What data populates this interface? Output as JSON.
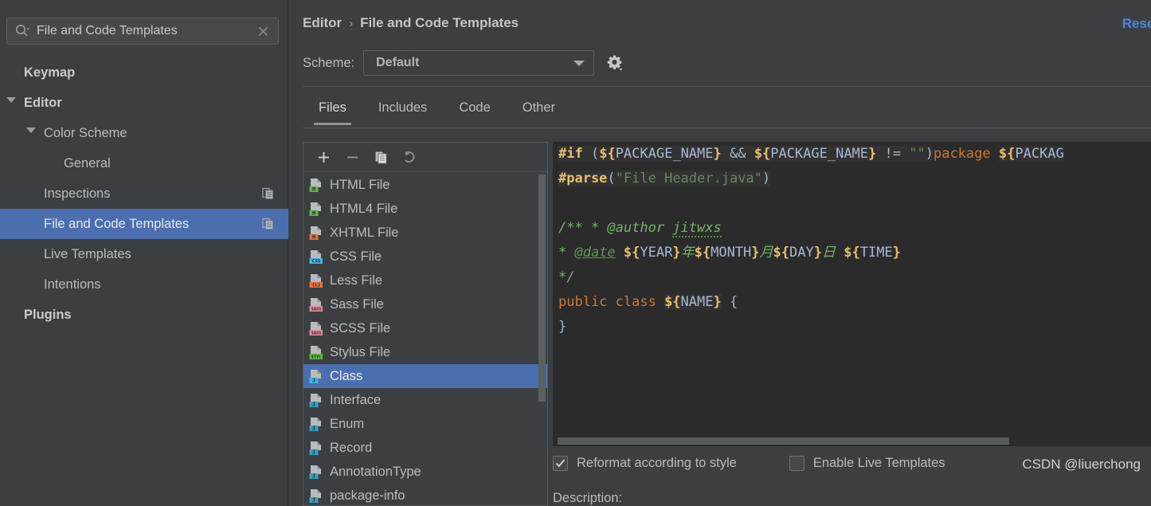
{
  "search": {
    "value": "File and Code Templates",
    "placeholder": "",
    "icon": "search-icon",
    "clear_icon": "close-icon"
  },
  "sidebar": {
    "items": [
      {
        "label": "Keymap",
        "indent": 30,
        "bold": true,
        "twisty": null,
        "selected": false,
        "copy_badge": false
      },
      {
        "label": "Editor",
        "indent": 30,
        "bold": true,
        "twisty": "down",
        "selected": false,
        "copy_badge": false
      },
      {
        "label": "Color Scheme",
        "indent": 55,
        "bold": false,
        "twisty": "down",
        "selected": false,
        "copy_badge": false
      },
      {
        "label": "General",
        "indent": 80,
        "bold": false,
        "twisty": null,
        "selected": false,
        "copy_badge": false
      },
      {
        "label": "Inspections",
        "indent": 55,
        "bold": false,
        "twisty": null,
        "selected": false,
        "copy_badge": true
      },
      {
        "label": "File and Code Templates",
        "indent": 55,
        "bold": false,
        "twisty": null,
        "selected": true,
        "copy_badge": true
      },
      {
        "label": "Live Templates",
        "indent": 55,
        "bold": false,
        "twisty": null,
        "selected": false,
        "copy_badge": false
      },
      {
        "label": "Intentions",
        "indent": 55,
        "bold": false,
        "twisty": null,
        "selected": false,
        "copy_badge": false
      },
      {
        "label": "Plugins",
        "indent": 30,
        "bold": true,
        "twisty": null,
        "selected": false,
        "copy_badge": false
      }
    ]
  },
  "header": {
    "breadcrumb_parent": "Editor",
    "breadcrumb_sep": "›",
    "breadcrumb_current": "File and Code Templates",
    "reset_label": "Reset",
    "scheme_label": "Scheme:",
    "scheme_value": "Default",
    "gear_icon": "gear-icon"
  },
  "tabs": [
    {
      "label": "Files",
      "active": true
    },
    {
      "label": "Includes",
      "active": false
    },
    {
      "label": "Code",
      "active": false
    },
    {
      "label": "Other",
      "active": false
    }
  ],
  "list_toolbar": [
    {
      "name": "add-template-button",
      "icon": "plus-icon"
    },
    {
      "name": "remove-template-button",
      "icon": "minus-icon"
    },
    {
      "name": "copy-template-button",
      "icon": "copy-icon"
    },
    {
      "name": "reset-template-button",
      "icon": "undo-icon"
    }
  ],
  "file_list": [
    {
      "label": "HTML File",
      "badge": "H",
      "badge_bg": "#62b543",
      "badge_fg": "#2b2b2b",
      "selected": false
    },
    {
      "label": "HTML4 File",
      "badge": "H",
      "badge_bg": "#62b543",
      "badge_fg": "#2b2b2b",
      "selected": false
    },
    {
      "label": "XHTML File",
      "badge": "H",
      "badge_bg": "#e8703a",
      "badge_fg": "#2b2b2b",
      "selected": false
    },
    {
      "label": "CSS File",
      "badge": "CSS",
      "badge_bg": "#40b6e0",
      "badge_fg": "#2b2b2b",
      "selected": false
    },
    {
      "label": "Less File",
      "badge": "{L}",
      "badge_bg": "#e8703a",
      "badge_fg": "#2b2b2b",
      "selected": false
    },
    {
      "label": "Sass File",
      "badge": "SASS",
      "badge_bg": "#e8899b",
      "badge_fg": "#2b2b2b",
      "selected": false
    },
    {
      "label": "SCSS File",
      "badge": "SASS",
      "badge_bg": "#e8899b",
      "badge_fg": "#2b2b2b",
      "selected": false
    },
    {
      "label": "Stylus File",
      "badge": "STYL",
      "badge_bg": "#62b543",
      "badge_fg": "#2b2b2b",
      "selected": false
    },
    {
      "label": "Class",
      "badge": "J",
      "badge_bg": "#40b6e0",
      "badge_fg": "#2b2b2b",
      "selected": true
    },
    {
      "label": "Interface",
      "badge": "J",
      "badge_bg": "#389fc0",
      "badge_fg": "#2b2b2b",
      "selected": false
    },
    {
      "label": "Enum",
      "badge": "J",
      "badge_bg": "#389fc0",
      "badge_fg": "#2b2b2b",
      "selected": false
    },
    {
      "label": "Record",
      "badge": "J",
      "badge_bg": "#389fc0",
      "badge_fg": "#2b2b2b",
      "selected": false
    },
    {
      "label": "AnnotationType",
      "badge": "J",
      "badge_bg": "#389fc0",
      "badge_fg": "#2b2b2b",
      "selected": false
    },
    {
      "label": "package-info",
      "badge": "J",
      "badge_bg": "#389fc0",
      "badge_fg": "#2b2b2b",
      "selected": false
    }
  ],
  "editor": {
    "lines": [
      {
        "selected": false,
        "tokens": [
          {
            "t": "#if ",
            "c": "k-dir",
            "hl": true
          },
          {
            "t": "(",
            "c": "k-op",
            "hl": true
          },
          {
            "t": "${",
            "c": "k-varbr",
            "hl": true
          },
          {
            "t": "PACKAGE_NAME",
            "c": "k-varname",
            "hl": true
          },
          {
            "t": "}",
            "c": "k-varbr",
            "hl": true
          },
          {
            "t": " && ",
            "c": "k-op",
            "hl": true
          },
          {
            "t": "${",
            "c": "k-varbr",
            "hl": true
          },
          {
            "t": "PACKAGE_NAME",
            "c": "k-varname",
            "hl": true
          },
          {
            "t": "}",
            "c": "k-varbr",
            "hl": true
          },
          {
            "t": " != ",
            "c": "k-op",
            "hl": true
          },
          {
            "t": "\"\"",
            "c": "k-str",
            "hl": true
          },
          {
            "t": ")",
            "c": "k-op",
            "hl": true
          },
          {
            "t": "package ",
            "c": "k-kw",
            "hl": false
          },
          {
            "t": "${",
            "c": "k-varbr",
            "hl": true
          },
          {
            "t": "PACKAG",
            "c": "k-varname",
            "hl": true
          }
        ]
      },
      {
        "selected": false,
        "tokens": [
          {
            "t": "#parse",
            "c": "k-dir",
            "hl": true
          },
          {
            "t": "(",
            "c": "k-op",
            "hl": true
          },
          {
            "t": "\"File Header.java\"",
            "c": "k-str",
            "hl": true
          },
          {
            "t": ")",
            "c": "k-op",
            "hl": true
          }
        ]
      },
      {
        "selected": false,
        "tokens": []
      },
      {
        "selected": true,
        "selwidth": 745,
        "caret": true,
        "tokens": [
          {
            "t": "/** * @author ",
            "c": "k-cmt-sel",
            "hl": false
          },
          {
            "t": "jitwxs",
            "c": "k-cmt-sel squig",
            "hl": false
          }
        ]
      },
      {
        "selected": true,
        "selwidth": 745,
        "tokens": [
          {
            "t": "* ",
            "c": "k-cmt-sel",
            "hl": false
          },
          {
            "t": "@date",
            "c": "k-cmt-u",
            "hl": false
          },
          {
            "t": " ",
            "c": "k-cmt-sel",
            "hl": false
          },
          {
            "t": "${",
            "c": "k-varbr",
            "hl": false
          },
          {
            "t": "YEAR",
            "c": "k-varname",
            "hl": false
          },
          {
            "t": "}",
            "c": "k-varbr",
            "hl": false
          },
          {
            "t": "年",
            "c": "k-cmt-sel",
            "hl": false
          },
          {
            "t": "${",
            "c": "k-varbr",
            "hl": false
          },
          {
            "t": "MONTH",
            "c": "k-varname",
            "hl": false
          },
          {
            "t": "}",
            "c": "k-varbr",
            "hl": false
          },
          {
            "t": "月",
            "c": "k-cmt-sel",
            "hl": false
          },
          {
            "t": "${",
            "c": "k-varbr",
            "hl": false
          },
          {
            "t": "DAY",
            "c": "k-varname",
            "hl": false
          },
          {
            "t": "}",
            "c": "k-varbr",
            "hl": false
          },
          {
            "t": "日 ",
            "c": "k-cmt-sel",
            "hl": false
          },
          {
            "t": "${",
            "c": "k-varbr",
            "hl": false
          },
          {
            "t": "TIME",
            "c": "k-varname",
            "hl": false
          },
          {
            "t": "}",
            "c": "k-varbr",
            "hl": false
          }
        ]
      },
      {
        "selected": true,
        "selwidth": 27,
        "tokens": [
          {
            "t": "*/",
            "c": "k-cmt-sel",
            "hl": false
          }
        ]
      },
      {
        "selected": false,
        "tokens": [
          {
            "t": "public class ",
            "c": "k-kw",
            "hl": false
          },
          {
            "t": "${",
            "c": "k-varbr",
            "hl": true
          },
          {
            "t": "NAME",
            "c": "k-varname",
            "hl": true
          },
          {
            "t": "}",
            "c": "k-varbr",
            "hl": true
          },
          {
            "t": " {",
            "c": "k-plain",
            "hl": false
          }
        ]
      },
      {
        "selected": false,
        "tokens": [
          {
            "t": "}",
            "c": "k-plain",
            "hl": false
          }
        ]
      }
    ]
  },
  "bottom": {
    "reformat_label": "Reformat according to style",
    "reformat_checked": true,
    "live_templates_label": "Enable Live Templates",
    "live_templates_checked": false,
    "description_label": "Description:"
  },
  "watermark": "CSDN @liuerchong",
  "colors": {
    "accent_selection": "#4b6eaf",
    "editor_selection": "#214283",
    "link": "#4a88df",
    "panel_bg": "#3c3f41",
    "editor_bg": "#2b2b2b"
  }
}
